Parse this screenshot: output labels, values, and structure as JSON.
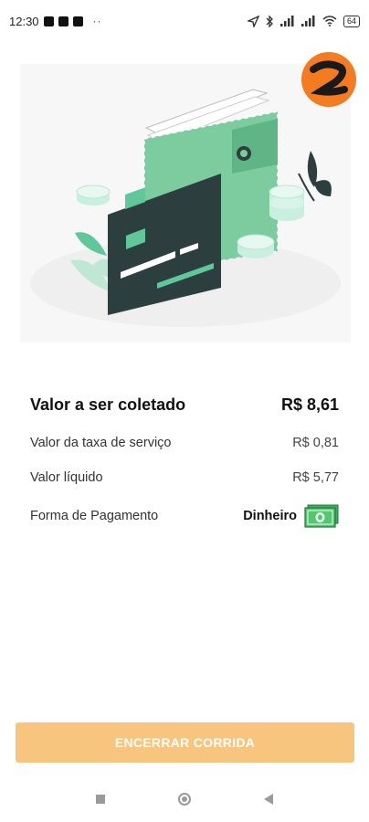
{
  "status_bar": {
    "time": "12:30",
    "overflow": "··",
    "battery": "64",
    "icons": [
      "navigation-icon",
      "bluetooth-icon",
      "signal-icon",
      "signal-icon",
      "wifi-icon",
      "battery-icon"
    ]
  },
  "logo": {
    "text": "zapy-app",
    "brand_color": "#f47b20"
  },
  "summary": {
    "collect_label": "Valor a ser coletado",
    "collect_value": "R$ 8,61",
    "fee_label": "Valor da taxa de serviço",
    "fee_value": "R$ 0,81",
    "net_label": "Valor líquido",
    "net_value": "R$ 5,77",
    "payment_label": "Forma de Pagamento",
    "payment_value": "Dinheiro",
    "payment_icon": "cash-icon"
  },
  "finish_button": {
    "label": "ENCERRAR CORRIDA",
    "color": "#f7c57e"
  },
  "colors": {
    "accent_green": "#7dcc9f",
    "card_dark": "#2c3e3e"
  }
}
